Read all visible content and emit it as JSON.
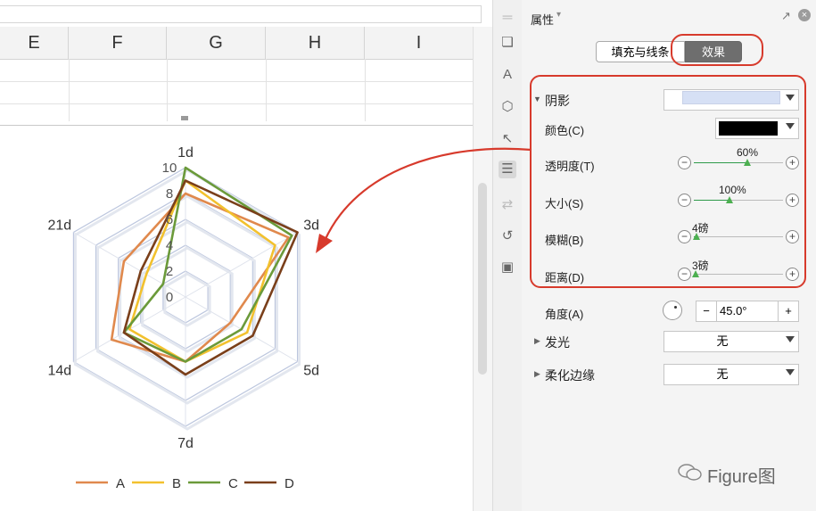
{
  "sheet": {
    "columns": [
      "E",
      "F",
      "G",
      "H",
      "I"
    ]
  },
  "chart": {
    "axes": [
      "1d",
      "3d",
      "5d",
      "7d",
      "14d",
      "21d"
    ],
    "ticks": [
      "0",
      "2",
      "4",
      "6",
      "8",
      "10"
    ],
    "series_colors": {
      "A": "#e0894d",
      "B": "#f2c12e",
      "C": "#6b9a3a",
      "D": "#7a3f1a"
    },
    "legend": [
      "A",
      "B",
      "C",
      "D"
    ]
  },
  "chart_data": {
    "type": "radar",
    "categories": [
      "1d",
      "3d",
      "5d",
      "7d",
      "14d",
      "21d"
    ],
    "rlim": [
      0,
      10
    ],
    "series": [
      {
        "name": "A",
        "values": [
          8.0,
          9.2,
          4.0,
          5.0,
          6.6,
          5.5
        ]
      },
      {
        "name": "B",
        "values": [
          9.0,
          8.0,
          5.5,
          5.0,
          5.0,
          3.5
        ]
      },
      {
        "name": "C",
        "values": [
          10.0,
          9.5,
          5.0,
          5.0,
          5.5,
          2.0
        ]
      },
      {
        "name": "D",
        "values": [
          9.0,
          10.0,
          6.0,
          6.0,
          5.5,
          4.0
        ]
      }
    ],
    "grid": true,
    "legend_position": "bottom"
  },
  "panel": {
    "title": "属性",
    "tab_fill": "填充与线条",
    "tab_effect": "效果",
    "shadow_label": "阴影",
    "shadow_color": "#d6e0f5",
    "color_label": "颜色(C)",
    "color_value": "#000000",
    "transparency_label": "透明度(T)",
    "transparency_value": "60%",
    "transparency_level": 0.6,
    "size_label": "大小(S)",
    "size_value": "100%",
    "size_level": 0.4,
    "blur_label": "模糊(B)",
    "blur_value": "4磅",
    "blur_level": 0.03,
    "distance_label": "距离(D)",
    "distance_value": "3磅",
    "distance_level": 0.02,
    "angle_label": "角度(A)",
    "angle_value": "45.0°",
    "angle_minus": "−",
    "angle_plus": "+",
    "glow_label": "发光",
    "glow_value": "无",
    "soft_edge_label": "柔化边缘",
    "soft_edge_value": "无"
  },
  "watermark": "Figure图"
}
